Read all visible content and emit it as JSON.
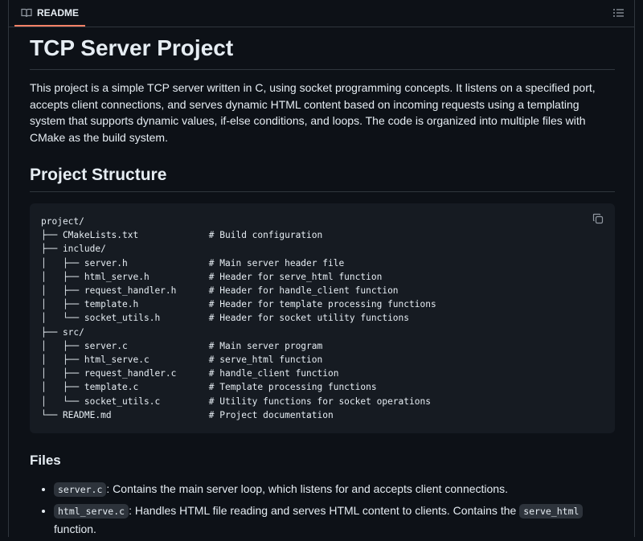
{
  "header": {
    "tab_label": "README"
  },
  "readme": {
    "title": "TCP Server Project",
    "intro": "This project is a simple TCP server written in C, using socket programming concepts. It listens on a specified port, accepts client connections, and serves dynamic HTML content based on incoming requests using a templating system that supports dynamic values, if-else conditions, and loops. The code is organized into multiple files with CMake as the build system.",
    "structure_heading": "Project Structure",
    "code_block": "project/\n├── CMakeLists.txt             # Build configuration\n├── include/\n│   ├── server.h               # Main server header file\n│   ├── html_serve.h           # Header for serve_html function\n│   ├── request_handler.h      # Header for handle_client function\n│   ├── template.h             # Header for template processing functions\n│   └── socket_utils.h         # Header for socket utility functions\n├── src/\n│   ├── server.c               # Main server program\n│   ├── html_serve.c           # serve_html function\n│   ├── request_handler.c      # handle_client function\n│   ├── template.c             # Template processing functions\n│   └── socket_utils.c         # Utility functions for socket operations\n└── README.md                  # Project documentation",
    "files_heading": "Files",
    "files": [
      {
        "name": "server.c",
        "description": ": Contains the main server loop, which listens for and accepts client connections."
      },
      {
        "name": "html_serve.c",
        "description": ": Handles HTML file reading and serves HTML content to clients. Contains the ",
        "code": "serve_html",
        "description_end": " function."
      }
    ]
  }
}
